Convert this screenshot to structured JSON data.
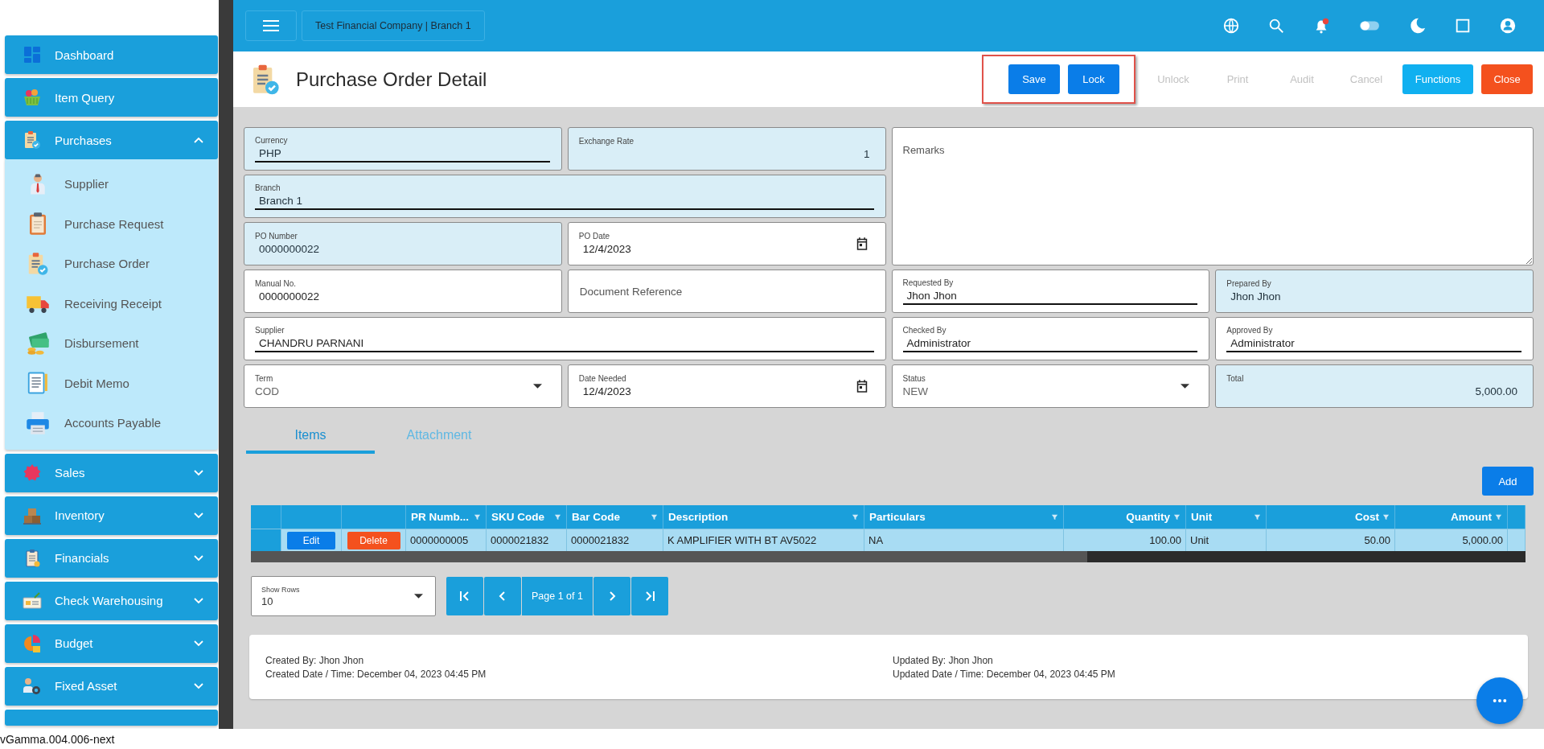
{
  "topbar": {
    "company": "Test Financial Company | Branch 1"
  },
  "sidebar": {
    "items": [
      {
        "label": "Dashboard"
      },
      {
        "label": "Item Query"
      },
      {
        "label": "Purchases",
        "expanded": true,
        "children": [
          {
            "label": "Supplier"
          },
          {
            "label": "Purchase Request"
          },
          {
            "label": "Purchase Order"
          },
          {
            "label": "Receiving Receipt"
          },
          {
            "label": "Disbursement"
          },
          {
            "label": "Debit Memo"
          },
          {
            "label": "Accounts Payable"
          }
        ]
      },
      {
        "label": "Sales",
        "expanded": false
      },
      {
        "label": "Inventory",
        "expanded": false
      },
      {
        "label": "Financials",
        "expanded": false
      },
      {
        "label": "Check Warehousing",
        "expanded": false
      },
      {
        "label": "Budget",
        "expanded": false
      },
      {
        "label": "Fixed Asset",
        "expanded": false
      }
    ]
  },
  "page": {
    "title": "Purchase Order Detail",
    "action_groups": [
      {
        "highlighted": true,
        "buttons": [
          {
            "label": "Save",
            "kind": "primary",
            "disabled": false
          },
          {
            "label": "Lock",
            "kind": "primary",
            "disabled": false
          }
        ]
      },
      {
        "highlighted": false,
        "buttons": [
          {
            "label": "Unlock",
            "kind": "plain",
            "disabled": true
          },
          {
            "label": "Print",
            "kind": "plain",
            "disabled": true
          },
          {
            "label": "Audit",
            "kind": "plain",
            "disabled": true
          },
          {
            "label": "Cancel",
            "kind": "plain",
            "disabled": true
          },
          {
            "label": "Functions",
            "kind": "info",
            "disabled": false
          },
          {
            "label": "Close",
            "kind": "danger",
            "disabled": false
          }
        ]
      }
    ]
  },
  "form": {
    "fields": [
      {
        "label": "Currency",
        "value": "PHP",
        "kind": "text",
        "readonly": true,
        "underline": true,
        "numeric": false
      },
      {
        "label": "Exchange Rate",
        "value": "1",
        "kind": "text",
        "readonly": true,
        "underline": false,
        "numeric": true
      },
      {
        "placeholder": "Remarks",
        "kind": "textarea"
      },
      {
        "label": "Branch",
        "value": "Branch 1",
        "kind": "text",
        "readonly": true,
        "underline": true,
        "numeric": false
      },
      {
        "label": "PO Number",
        "value": "0000000022",
        "kind": "text",
        "readonly": true,
        "underline": false,
        "numeric": false
      },
      {
        "label": "PO Date",
        "value": "12/4/2023",
        "kind": "date",
        "readonly": false,
        "underline": false,
        "numeric": false
      },
      {
        "label": "Manual No.",
        "value": "0000000022",
        "kind": "text",
        "readonly": false,
        "underline": false,
        "numeric": false
      },
      {
        "placeholder": "Document Reference",
        "kind": "placeholder"
      },
      {
        "label": "Requested By",
        "value": "Jhon Jhon",
        "kind": "text",
        "readonly": false,
        "underline": true,
        "numeric": false
      },
      {
        "label": "Prepared By",
        "value": "Jhon Jhon",
        "kind": "text",
        "readonly": true,
        "underline": false,
        "numeric": false
      },
      {
        "label": "Supplier",
        "value": "CHANDRU PARNANI",
        "kind": "text",
        "readonly": false,
        "underline": true,
        "numeric": false
      },
      {
        "label": "Checked By",
        "value": "Administrator",
        "kind": "text",
        "readonly": false,
        "underline": true,
        "numeric": false
      },
      {
        "label": "Approved By",
        "value": "Administrator",
        "kind": "text",
        "readonly": false,
        "underline": true,
        "numeric": false
      },
      {
        "label": "Term",
        "value": "COD",
        "kind": "select",
        "readonly": false,
        "underline": false,
        "numeric": false
      },
      {
        "label": "Date Needed",
        "value": "12/4/2023",
        "kind": "date",
        "readonly": false,
        "underline": false,
        "numeric": false
      },
      {
        "label": "Status",
        "value": "NEW",
        "kind": "select",
        "readonly": false,
        "underline": false,
        "numeric": false
      },
      {
        "label": "Total",
        "value": "5,000.00",
        "kind": "text",
        "readonly": true,
        "underline": false,
        "numeric": true
      }
    ]
  },
  "tabs": [
    {
      "label": "Items",
      "selected": true
    },
    {
      "label": "Attachment",
      "selected": false
    }
  ],
  "add_button": "Add",
  "table": {
    "columns": [
      {
        "kind": "row_header"
      },
      {
        "kind": "edit_action"
      },
      {
        "kind": "delete_action"
      },
      {
        "kind": "data",
        "label": "PR Numb...",
        "numeric": false
      },
      {
        "kind": "data",
        "label": "SKU Code",
        "numeric": false
      },
      {
        "kind": "data",
        "label": "Bar Code",
        "numeric": false
      },
      {
        "kind": "data",
        "label": "Description",
        "numeric": false
      },
      {
        "kind": "data",
        "label": "Particulars",
        "numeric": false
      },
      {
        "kind": "data",
        "label": "Quantity",
        "numeric": true
      },
      {
        "kind": "data",
        "label": "Unit",
        "numeric": false
      },
      {
        "kind": "data",
        "label": "Cost",
        "numeric": true
      },
      {
        "kind": "data",
        "label": "Amount",
        "numeric": true
      }
    ],
    "rows": [
      {
        "cells": [
          "",
          "Edit",
          "Delete",
          "0000000005",
          "0000021832",
          "0000021832",
          "K AMPLIFIER WITH BT AV5022",
          "NA",
          "100.00",
          "Unit",
          "50.00",
          "5,000.00"
        ]
      }
    ]
  },
  "pager": {
    "show_rows": {
      "label": "Show Rows",
      "value": "10"
    },
    "page_label": "Page 1 of 1"
  },
  "audit": {
    "left": [
      "Created By: Jhon Jhon",
      "Created Date / Time: December 04, 2023 04:45 PM"
    ],
    "right": [
      "Updated By: Jhon Jhon",
      "Updated Date / Time: December 04, 2023 04:45 PM"
    ]
  },
  "version": "vGamma.004.006-next"
}
